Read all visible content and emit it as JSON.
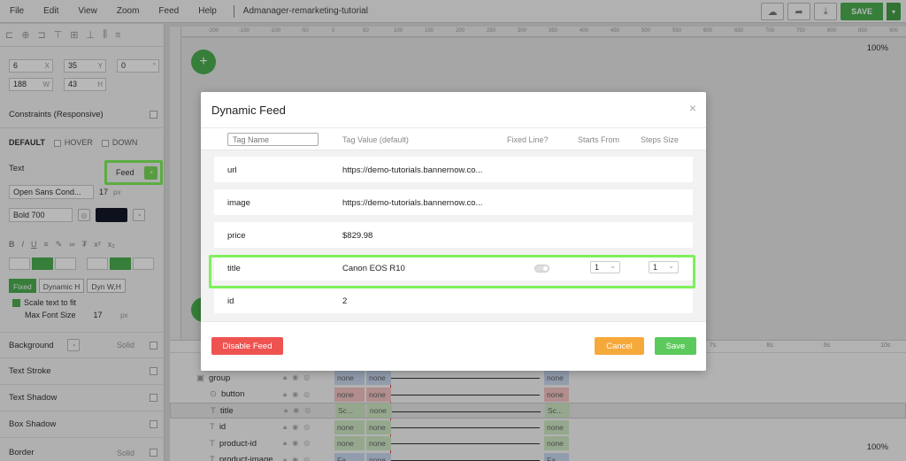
{
  "menu": [
    "File",
    "Edit",
    "View",
    "Zoom",
    "Feed",
    "Help"
  ],
  "doc_title": "Admanager-remarketing-tutorial",
  "toolbar": {
    "save_label": "SAVE"
  },
  "left_panel": {
    "x": "6",
    "y": "35",
    "rotation": "0",
    "width": "188",
    "height": "43",
    "x_unit": "X",
    "y_unit": "Y",
    "rot_unit": "°",
    "w_unit": "W",
    "h_unit": "H",
    "constraints_label": "Constraints (Responsive)",
    "state_default": "DEFAULT",
    "state_hover": "HOVER",
    "state_down": "DOWN",
    "text_label": "Text",
    "feed_label": "Feed",
    "font_family": "Open Sans Cond...",
    "font_size": "17",
    "font_unit": "px",
    "font_weight": "Bold 700",
    "mode_fixed": "Fixed",
    "mode_dynamic_h": "Dynamic H",
    "mode_dyn_wh": "Dyn W,H",
    "scale_text": "Scale text to fit",
    "max_font_label": "Max Font Size",
    "max_font_value": "17",
    "max_font_unit": "px",
    "sections": [
      {
        "label": "Background",
        "extra": "Solid"
      },
      {
        "label": "Text Stroke",
        "extra": ""
      },
      {
        "label": "Text Shadow",
        "extra": ""
      },
      {
        "label": "Box Shadow",
        "extra": ""
      },
      {
        "label": "Border",
        "extra": "Solid"
      }
    ]
  },
  "ruler_ticks": [
    "-200",
    "-150",
    "-100",
    "-50",
    "0",
    "50",
    "100",
    "150",
    "200",
    "250",
    "300",
    "350",
    "400",
    "450",
    "500",
    "550",
    "600",
    "650",
    "700",
    "750",
    "800",
    "850",
    "900"
  ],
  "zoom_top": "100%",
  "zoom_bottom": "100%",
  "timeline": {
    "seconds": [
      "7s",
      "8s",
      "9s",
      "10s"
    ],
    "layers": [
      {
        "name": "group",
        "a": "none",
        "b": "none",
        "c": "none",
        "color": "blue"
      },
      {
        "name": "button",
        "a": "none",
        "b": "none",
        "c": "none",
        "color": "red"
      },
      {
        "name": "title",
        "a": "Sc...",
        "b": "none",
        "c": "Sc...",
        "color": "green"
      },
      {
        "name": "id",
        "a": "none",
        "b": "none",
        "c": "none",
        "color": "green"
      },
      {
        "name": "product-id",
        "a": "none",
        "b": "none",
        "c": "none",
        "color": "green"
      },
      {
        "name": "product-image",
        "a": "Fa...",
        "b": "none",
        "c": "Fa...",
        "color": "blue"
      }
    ]
  },
  "modal": {
    "title": "Dynamic Feed",
    "close": "×",
    "tag_name_placeholder": "Tag Name",
    "col_value": "Tag Value (default)",
    "col_fixed": "Fixed Line?",
    "col_starts": "Starts From",
    "col_steps": "Steps Size",
    "rows": [
      {
        "name": "url",
        "value": "https://demo-tutorials.bannernow.co..."
      },
      {
        "name": "image",
        "value": "https://demo-tutorials.bannernow.co..."
      },
      {
        "name": "price",
        "value": "$829.98"
      },
      {
        "name": "title",
        "value": "Canon EOS R10",
        "starts_from": "1",
        "steps_size": "1"
      },
      {
        "name": "id",
        "value": "2"
      }
    ],
    "disable_label": "Disable Feed",
    "cancel_label": "Cancel",
    "save_label": "Save"
  },
  "colors": {
    "accent_green": "#4caf50",
    "highlight_green": "#7ef05b",
    "disable_red": "#ef5350",
    "cancel_orange": "#f6a93b",
    "save_green": "#5cc95c"
  }
}
